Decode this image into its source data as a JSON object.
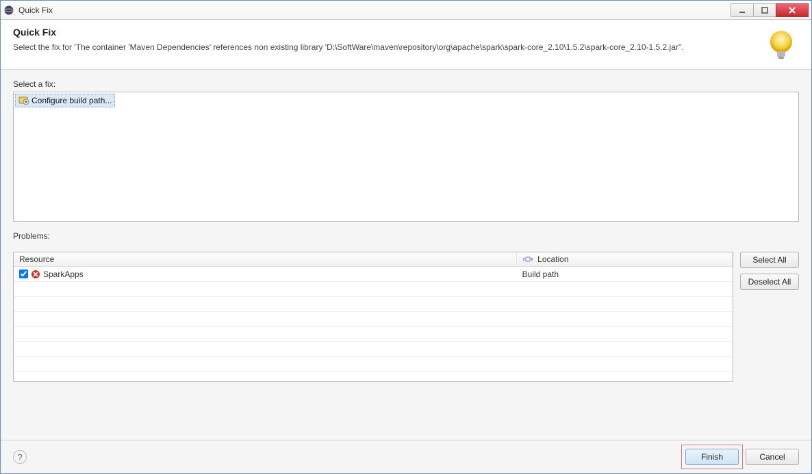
{
  "window": {
    "title": "Quick Fix"
  },
  "header": {
    "title": "Quick Fix",
    "description": "Select the fix for 'The container 'Maven Dependencies' references non existing library 'D:\\SoftWare\\maven\\repository\\org\\apache\\spark\\spark-core_2.10\\1.5.2\\spark-core_2.10-1.5.2.jar''."
  },
  "labels": {
    "select_fix": "Select a fix:",
    "problems": "Problems:"
  },
  "fixes": {
    "items": [
      {
        "label": "Configure build path...",
        "icon": "project-settings-icon",
        "selected": true
      }
    ]
  },
  "problems_table": {
    "columns": {
      "resource": "Resource",
      "location": "Location"
    },
    "rows": [
      {
        "checked": true,
        "resource": "SparkApps",
        "location": "Build path"
      }
    ]
  },
  "buttons": {
    "select_all": "Select All",
    "deselect_all": "Deselect All",
    "finish": "Finish",
    "cancel": "Cancel"
  }
}
